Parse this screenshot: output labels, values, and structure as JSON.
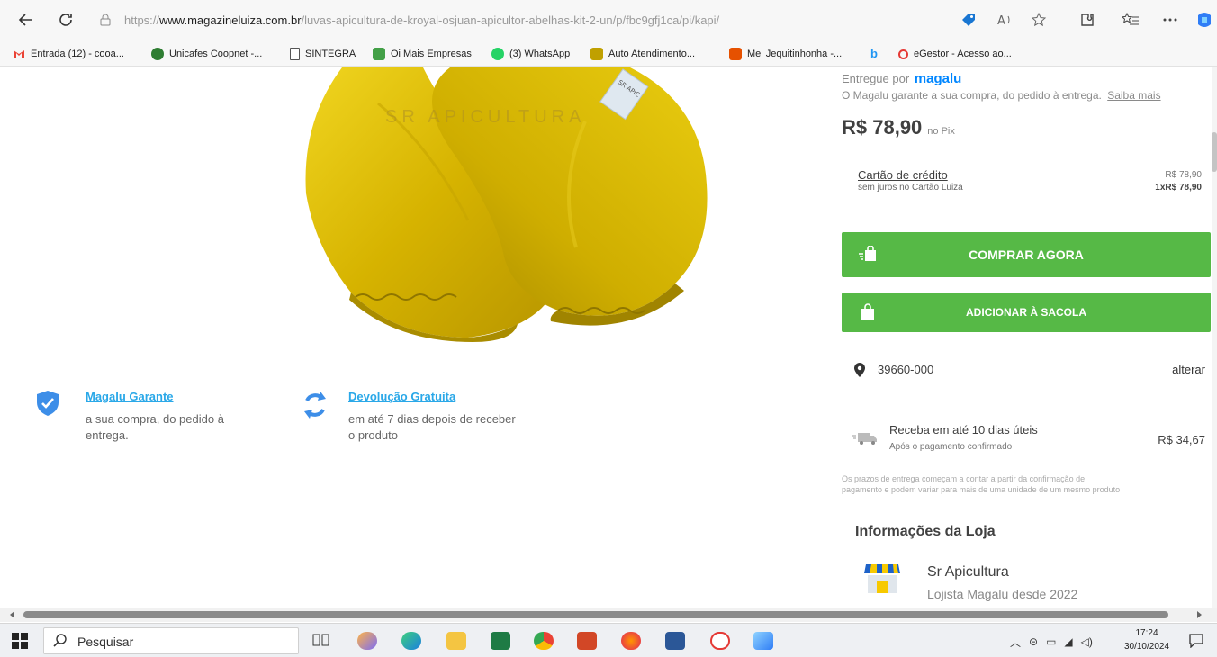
{
  "browser": {
    "url_prefix": "https://",
    "url_domain": "www.magazineluiza.com.br",
    "url_path": "/luvas-apicultura-de-kroyal-osjuan-apicultor-abelhas-kit-2-un/p/fbc9gfj1ca/pi/kapi/",
    "bookmarks": [
      {
        "label": "Entrada (12) - cooa...",
        "color": "#ea4335"
      },
      {
        "label": "Unicafes Coopnet -...",
        "color": "#2e7d32"
      },
      {
        "label": "SINTEGRA",
        "color": "#ffffff"
      },
      {
        "label": "Oi Mais Empresas",
        "color": "#43a047"
      },
      {
        "label": "(3) WhatsApp",
        "color": "#25d366"
      },
      {
        "label": "Auto Atendimento...",
        "color": "#c0a000"
      },
      {
        "label": "Mel Jequitinhonha -...",
        "color": "#e65100"
      },
      {
        "label": "",
        "color": "#2196f3"
      },
      {
        "label": "eGestor - Acesso ao...",
        "color": "#e53935"
      }
    ]
  },
  "product": {
    "watermark": "SR APICULTURA",
    "tag_text": "SR APIC"
  },
  "guarantees": [
    {
      "title": "Magalu Garante",
      "line1": "a sua compra, do pedido à",
      "line2": "entrega."
    },
    {
      "title": "Devolução Gratuita",
      "line1": "em até 7 dias depois de receber",
      "line2": "o produto"
    }
  ],
  "sidebar": {
    "delivered_by_prefix": "Entregue por",
    "delivered_by_brand": "magalu",
    "guarantee_text": "O Magalu garante a sua compra, do pedido à entrega.",
    "know_more": "Saiba mais",
    "price": "R$ 78,90",
    "price_suffix": "no Pix",
    "card_title": "Cartão de crédito",
    "card_sub": "sem juros no Cartão Luiza",
    "card_price": "R$ 78,90",
    "card_installment": "1xR$ 78,90",
    "buy_now": "COMPRAR AGORA",
    "add_to_bag": "ADICIONAR À SACOLA",
    "zipcode": "39660-000",
    "change": "alterar",
    "delivery_title": "Receba em até 10 dias úteis",
    "delivery_sub": "Após o pagamento confirmado",
    "delivery_price": "R$ 34,67",
    "disclaimer_1": "Os prazos de entrega começam a contar a partir da confirmação de",
    "disclaimer_2": "pagamento e podem variar para mais de uma unidade de um mesmo produto",
    "store_section": "Informações da Loja",
    "store_name": "Sr Apicultura",
    "store_since": "Lojista Magalu desde 2022"
  },
  "taskbar": {
    "search_placeholder": "Pesquisar",
    "time": "17:24",
    "date": "30/10/2024"
  },
  "colors": {
    "green": "#56b946",
    "link_blue": "#2aa8e8",
    "magalu_blue": "#0086ff",
    "glove_yellow": "#d8b600"
  }
}
